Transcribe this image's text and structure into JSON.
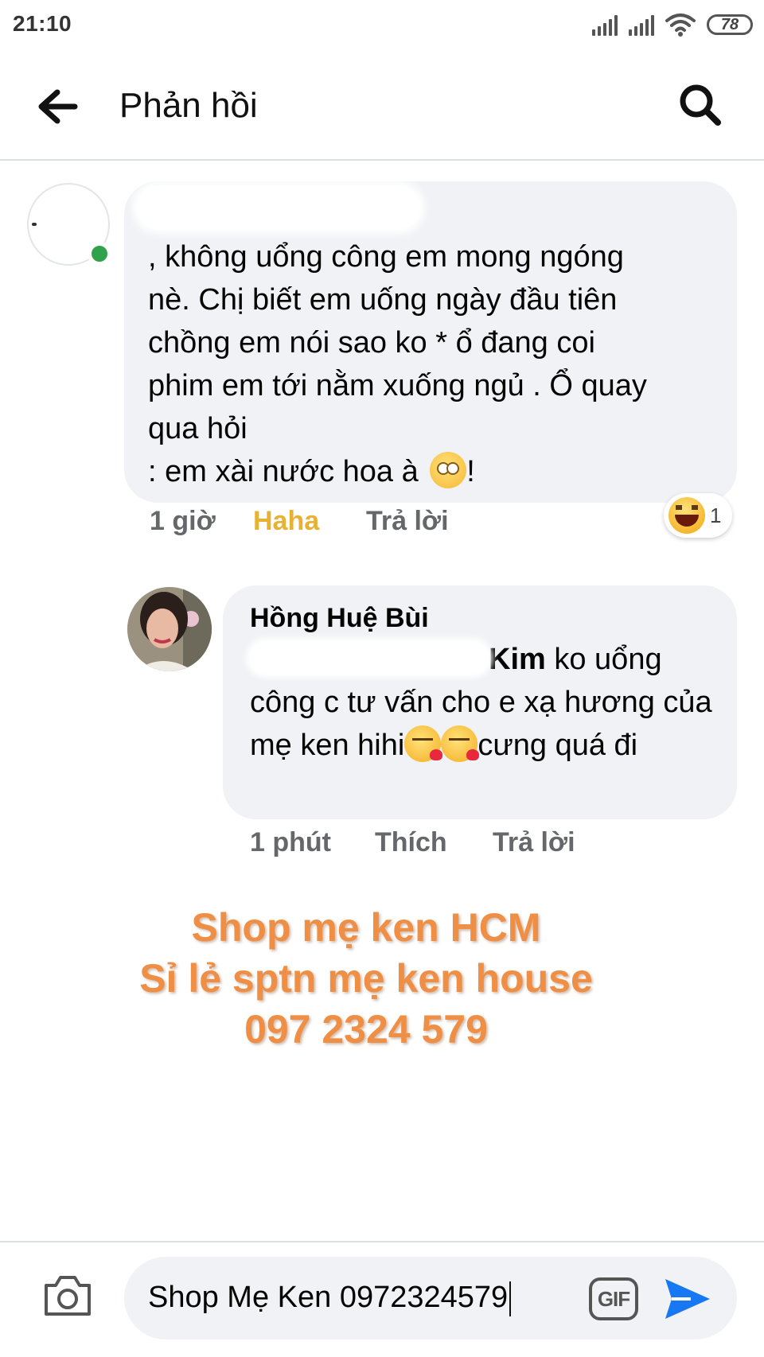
{
  "status_bar": {
    "time": "21:10",
    "battery": "78"
  },
  "header": {
    "title": "Phản hồi"
  },
  "comment1": {
    "text": ", không uổng công em mong ngóng\nnè.  Chị biết em uống ngày đầu tiên\nchồng em nói sao ko *  ổ đang coi\nphim em tới nằm xuống ngủ . Ổ quay\nqua hỏi\n : em xài nước hoa à ",
    "text_end": "!",
    "emoji": "face-with-rolling-eyes",
    "time": "1 giờ",
    "reaction_label": "Haha",
    "reply_label": "Trả lời",
    "reaction_count": "1"
  },
  "comment2": {
    "author": "Hồng Huệ Bùi",
    "mention_tail": "Kim",
    "text_a": " ko uổng công c tư vấn cho e xạ hương của mẹ ken hihi",
    "text_b": "cưng quá đi",
    "emoji": "face-blowing-kiss",
    "time": "1 phút",
    "like_label": "Thích",
    "reply_label": "Trả lời"
  },
  "watermark": {
    "line1": "Shop mẹ ken HCM",
    "line2": "Sỉ lẻ sptn mẹ ken house",
    "line3": "097 2324 579",
    "color": "#ef8f45"
  },
  "composer": {
    "input_value": "Shop Mẹ Ken 0972324579",
    "gif_label": "GIF"
  },
  "colors": {
    "accent": "#1877f2",
    "online": "#31a24c",
    "bubble": "#f0f2f5",
    "haha": "#e8b134"
  }
}
